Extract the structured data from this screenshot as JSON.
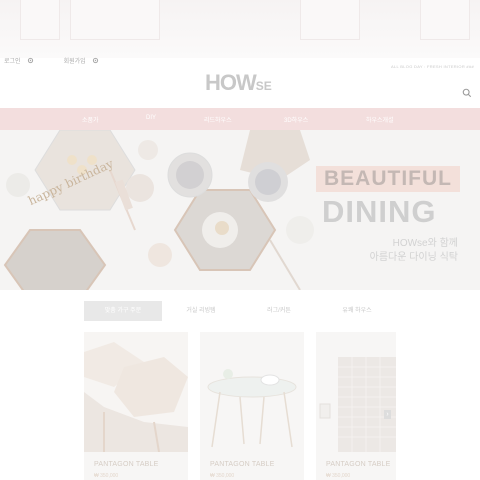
{
  "util": {
    "login": "로그인",
    "join": "회원가입"
  },
  "notice": "ALL BLOG DAY : FRESH INTERIOR ###",
  "logo": {
    "main": "HOW",
    "suffix": "SE"
  },
  "nav": {
    "items": [
      "소품가",
      "DIY",
      "리드하우스",
      "3D하우스",
      "하우스개설"
    ]
  },
  "hero": {
    "line1": "BEAUTIFUL",
    "line2": "DINING",
    "sub1": "HOWse와 함께",
    "sub2": "아름다운 다이닝 식탁",
    "cake_topper": "happy birthday"
  },
  "tabs": {
    "items": [
      "맞춤 가구 주문",
      "거실 리빙템",
      "러그/커튼",
      "유쾌 하우스"
    ],
    "active_index": 0
  },
  "products": [
    {
      "name": "PANTAGON TABLE",
      "price": "₩ 350,000"
    },
    {
      "name": "PANTAGON TABLE",
      "price": "₩ 350,000"
    },
    {
      "name": "PANTAGON TABLE",
      "price": "₩ 350,000"
    }
  ],
  "carousel": {
    "next_label": "›"
  },
  "colors": {
    "nav_bg": "#f3dede",
    "hero_badge_bg": "#f3e0da",
    "tab_active_bg": "#e8e8e8"
  }
}
